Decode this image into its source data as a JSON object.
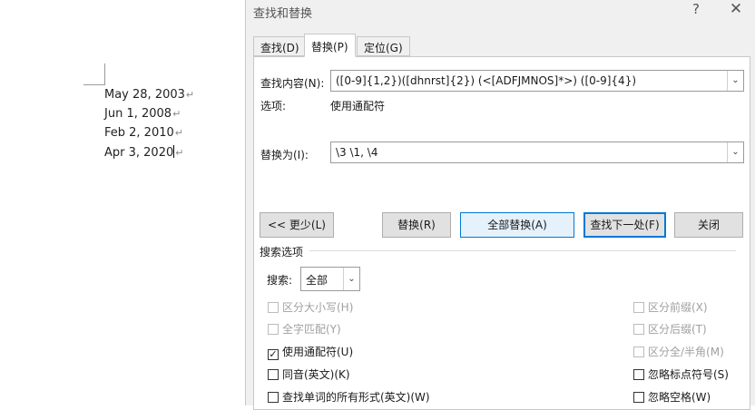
{
  "document": {
    "lines": [
      "May 28, 2003",
      "Jun 1, 2008",
      "Feb 2, 2010",
      "Apr 3, 2020"
    ],
    "paragraph_mark": "↵"
  },
  "dialog": {
    "title": "查找和替换",
    "help": "?",
    "close": "✕",
    "tabs": [
      "查找(D)",
      "替换(P)",
      "定位(G)"
    ],
    "find_label": "查找内容(N):",
    "find_value": "([0-9]{1,2})([dhnrst]{2}) (<[ADFJMNOS]*>) ([0-9]{4})",
    "options_label": "选项:",
    "options_value": "使用通配符",
    "replace_label": "替换为(I):",
    "replace_value": "\\3 \\1, \\4",
    "buttons": {
      "less": "<< 更少(L)",
      "replace": "替换(R)",
      "replace_all": "全部替换(A)",
      "find_next": "查找下一处(F)",
      "close": "关闭"
    },
    "search_options_title": "搜索选项",
    "search_label": "搜索:",
    "search_value": "全部",
    "checkboxes_left": [
      {
        "label": "区分大小写(H)",
        "checked": false,
        "disabled": true
      },
      {
        "label": "全字匹配(Y)",
        "checked": false,
        "disabled": true
      },
      {
        "label": "使用通配符(U)",
        "checked": true,
        "disabled": false
      },
      {
        "label": "同音(英文)(K)",
        "checked": false,
        "disabled": false
      },
      {
        "label": "查找单词的所有形式(英文)(W)",
        "checked": false,
        "disabled": false
      }
    ],
    "checkboxes_right": [
      {
        "label": "区分前缀(X)",
        "checked": false,
        "disabled": true
      },
      {
        "label": "区分后缀(T)",
        "checked": false,
        "disabled": true
      },
      {
        "label": "区分全/半角(M)",
        "checked": false,
        "disabled": true
      },
      {
        "label": "忽略标点符号(S)",
        "checked": false,
        "disabled": false
      },
      {
        "label": "忽略空格(W)",
        "checked": false,
        "disabled": false
      }
    ],
    "check_mark": "✓",
    "arrow": "⌄"
  }
}
